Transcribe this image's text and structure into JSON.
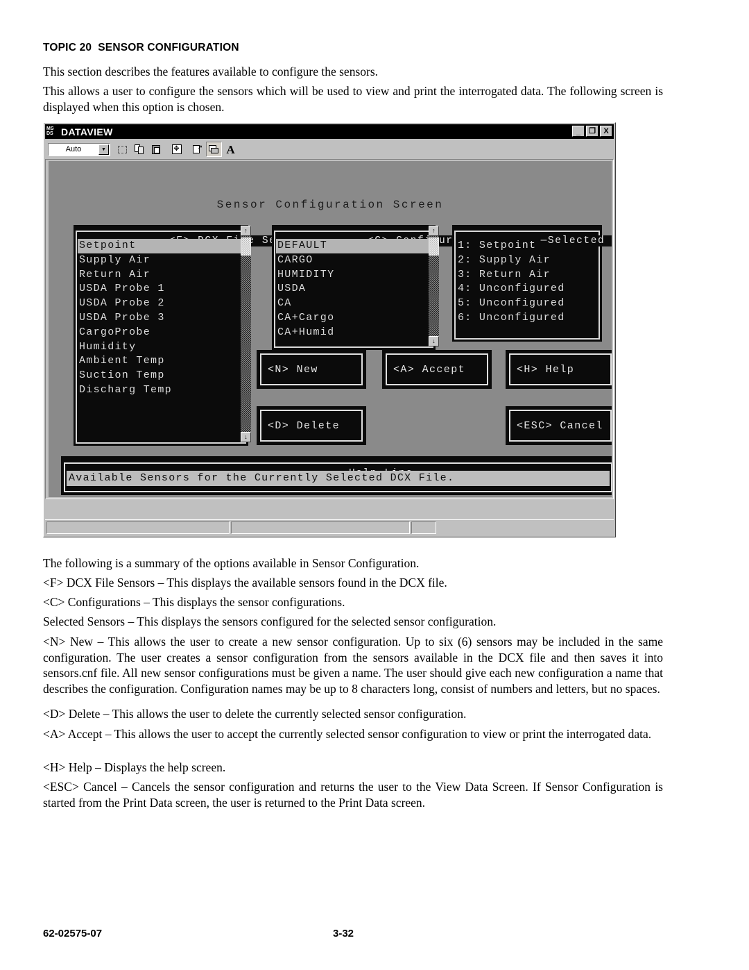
{
  "document": {
    "heading": "TOPIC 20  SENSOR CONFIGURATION",
    "intro1": "This section describes the features available to configure the sensors.",
    "intro2": "This allows a user to configure the sensors which will be used to view and print the interrogated data. The following screen is displayed when this option is chosen.",
    "summary_lead": "The following is a summary of the options available in Sensor Configuration.",
    "opt_f": "<F> DCX File Sensors – This displays the available sensors found in the DCX file.",
    "opt_c": "<C> Configurations – This displays the sensor configurations.",
    "opt_selected": "Selected Sensors – This displays the sensors configured for the selected sensor configuration.",
    "opt_n": "<N> New – This allows the user to create a new sensor configuration. Up to six (6) sensors may be included in the same configuration. The user creates a sensor configuration from the sensors available in the DCX file and then saves it into sensors.cnf file. All new sensor configurations must be given a name. The user should give each new configuration a name that describes the configuration. Configuration names may be up to 8 characters long, consist of numbers and letters, but no spaces.",
    "opt_d": "<D> Delete – This allows the user to delete the currently selected sensor configuration.",
    "opt_a": "<A> Accept – This allows the user to accept the currently selected sensor configuration to view or print the interrogated data.",
    "opt_h": "<H> Help – Displays the help screen.",
    "opt_esc": "<ESC> Cancel – Cancels the sensor configuration and returns the user to the View Data Screen. If Sensor Configuration is started from the Print Data screen, the user is returned to the Print Data screen."
  },
  "footer": {
    "document_number": "62-02575-07",
    "page_number": "3-32"
  },
  "window": {
    "title": "DATAVIEW",
    "icon": "msdos-icon",
    "minimize_label": "_",
    "restore_label": "❐",
    "close_label": "X",
    "toolbar": {
      "font_size_value": "Auto",
      "dropdown_arrow": "▼",
      "buttons": [
        {
          "name": "mark-button",
          "icon": "mark-icon"
        },
        {
          "name": "copy-button",
          "icon": "copy-icon"
        },
        {
          "name": "paste-button",
          "icon": "paste-icon"
        },
        {
          "name": "fullscreen-button",
          "icon": "fullscreen-icon"
        },
        {
          "name": "properties-button",
          "icon": "properties-icon"
        },
        {
          "name": "background-button",
          "icon": "background-icon"
        },
        {
          "name": "font-button",
          "icon": "font-a-icon",
          "glyph": "A"
        }
      ]
    }
  },
  "screen": {
    "title": "Sensor Configuration Screen",
    "dcx_panel": {
      "caption": "—<F> DCX File Sensors—",
      "items": [
        "Setpoint",
        "Supply Air",
        "Return Air",
        "USDA Probe 1",
        "USDA Probe 2",
        "USDA Probe 3",
        "CargoProbe",
        "Humidity",
        "Ambient Temp",
        "Suction Temp",
        "Discharg Temp"
      ],
      "selected_index": 0,
      "scroll_up": "↑",
      "scroll_down": "↓"
    },
    "config_panel": {
      "caption": "—<C> Configurations—",
      "items": [
        "DEFAULT",
        "CARGO",
        "HUMIDITY",
        "USDA",
        "CA",
        "CA+Cargo",
        "CA+Humid"
      ],
      "selected_index": 0,
      "scroll_up": "↑",
      "scroll_down": "↓"
    },
    "selected_panel": {
      "caption": "—Selected Sensors—",
      "items": [
        "1: Setpoint",
        "2: Supply Air",
        "3: Return Air",
        "4: Unconfigured",
        "5: Unconfigured",
        "6: Unconfigured"
      ]
    },
    "buttons": {
      "new": "<N> New",
      "accept": "<A> Accept",
      "help": "<H> Help",
      "delete": "<D> Delete",
      "cancel": "<ESC> Cancel"
    },
    "help_line": {
      "caption": "—Help Line—",
      "text": "Available Sensors for the Currently Selected DCX File."
    }
  }
}
